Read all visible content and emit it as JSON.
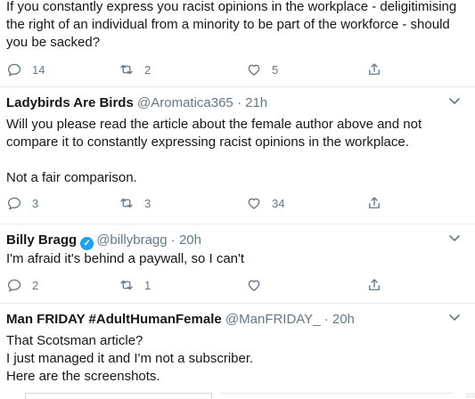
{
  "tweet1": {
    "text": "If you constantly express you racist opinions in the workplace - deligitimising the right of an individual from a minority to be part of the workforce - should you be sacked?",
    "replies": "14",
    "retweets": "2",
    "likes": "5"
  },
  "tweet2": {
    "name": "Ladybirds Are Birds",
    "handle": "@Aromatica365 · 21h",
    "text": "Will you please read the article about the female author above and not compare it to constantly expressing racist opinions in the workplace.\n\nNot a fair comparison.",
    "replies": "3",
    "retweets": "3",
    "likes": "34"
  },
  "tweet3": {
    "name": "Billy Bragg",
    "handle": "@billybragg · 20h",
    "text": "I'm afraid it's behind a paywall, so I can't",
    "replies": "2",
    "retweets": "1",
    "likes": ""
  },
  "tweet4": {
    "name": "Man FRIDAY #AdultHumanFemale",
    "handle": "@ManFRIDAY_ · 20h",
    "text": "That Scotsman article?\nI just managed it and I'm not a subscriber.\nHere are the screenshots."
  },
  "colors": {
    "muted": "#657786",
    "verified": "#1da1f2",
    "divider": "#e6ecf0"
  },
  "icons": [
    "reply-icon",
    "retweet-icon",
    "like-icon",
    "share-icon",
    "chevron-down-icon",
    "verified-icon"
  ]
}
